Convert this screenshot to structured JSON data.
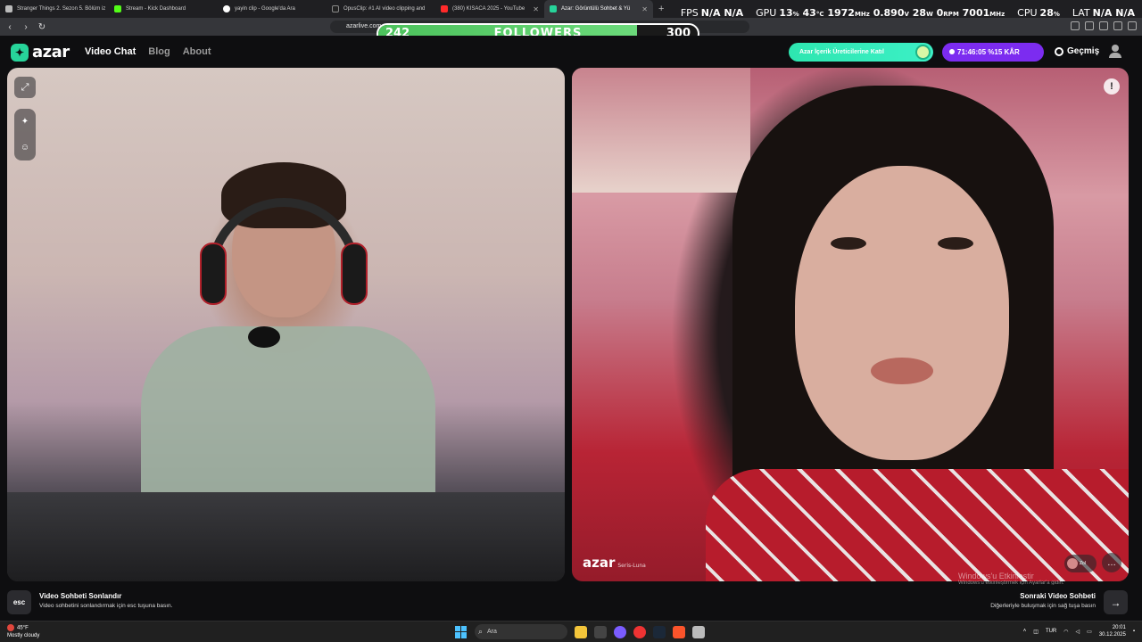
{
  "browser": {
    "tabs": [
      {
        "title": "Stranger Things 2. Sezon 5. Bölüm iz",
        "color": "#cfcfcf"
      },
      {
        "title": "Stream - Kick Dashboard",
        "color": "#53fc18"
      },
      {
        "title": "yayin clip - Google'da Ara",
        "color": "#ffffff"
      },
      {
        "title": "OpusClip: #1 AI video clipping and",
        "color": "#ffffff"
      },
      {
        "title": "(380) KISACA 2025 - YouTube",
        "color": "#ff2a2a"
      },
      {
        "title": "Azar: Görüntülü Sohbet & Yü",
        "color": "#27d49a"
      }
    ],
    "url": "azarlive.com"
  },
  "overlay": {
    "fps_label": "FPS",
    "fps_value": "N/A",
    "fps_value2": "N/A",
    "gpu_label": "GPU",
    "gpu_load": "13",
    "gpu_temp": "43",
    "gpu_clock": "1972",
    "gpu_volt": "0.890",
    "gpu_power": "28",
    "gpu_fan": "0",
    "gpu_mem": "7001",
    "cpu_label": "CPU",
    "cpu_load": "28",
    "lat_label": "LAT",
    "lat_value": "N/A",
    "lat_value2": "N/A"
  },
  "followers": {
    "current": "242",
    "goal": "300",
    "label": "FOLLOWERS",
    "progress": 0.81
  },
  "app": {
    "logo": "azar",
    "nav": [
      "Video Chat",
      "Blog",
      "About"
    ],
    "creator_button": "Azar İçerik Üreticilerine Katıl",
    "promo_timer": "71:46:05",
    "promo_label": "%15 KÂR",
    "history_label": "Geçmiş"
  },
  "remote": {
    "watermark": "azar",
    "handle": "Seris-Luna",
    "gift_label": "Zol"
  },
  "windows_activation": {
    "title": "Windows'u Etkinleştir",
    "subtitle": "Windows'u etkinleştirmek için Ayarlar'a gidin."
  },
  "bottom": {
    "esc_key": "esc",
    "end_title": "Video Sohbeti Sonlandır",
    "end_sub": "Video sohbetini sonlandırmak için esc tuşuna basın.",
    "next_title": "Sonraki Video Sohbeti",
    "next_sub": "Diğerleriyle buluşmak için sağ tuşa basın",
    "next_key": "→"
  },
  "taskbar": {
    "weather_temp": "45°F",
    "weather_desc": "Mostly cloudy",
    "search_placeholder": "Ara",
    "lang": "TUR",
    "time": "20:01",
    "date": "30.12.2025"
  }
}
